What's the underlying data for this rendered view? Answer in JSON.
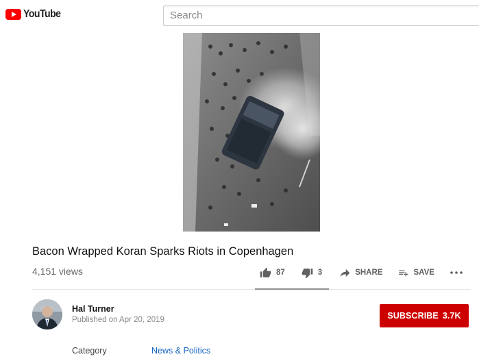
{
  "masthead": {
    "logo_text": "YouTube",
    "search_placeholder": "Search"
  },
  "video": {
    "title": "Bacon Wrapped Koran Sparks Riots in Copenhagen",
    "views": "4,151 views",
    "likes": "87",
    "dislikes": "3",
    "like_ratio": 0.967
  },
  "actions": {
    "share_label": "SHARE",
    "save_label": "SAVE"
  },
  "channel": {
    "name": "Hal Turner",
    "published": "Published on Apr 20, 2019",
    "subscribe_label": "SUBSCRIBE",
    "subscriber_count": "3.7K"
  },
  "metadata": {
    "category_label": "Category",
    "category_value": "News & Politics"
  },
  "colors": {
    "brand_red": "#ff0000",
    "subscribe_red": "#cc0000",
    "link_blue": "#1565c0"
  }
}
